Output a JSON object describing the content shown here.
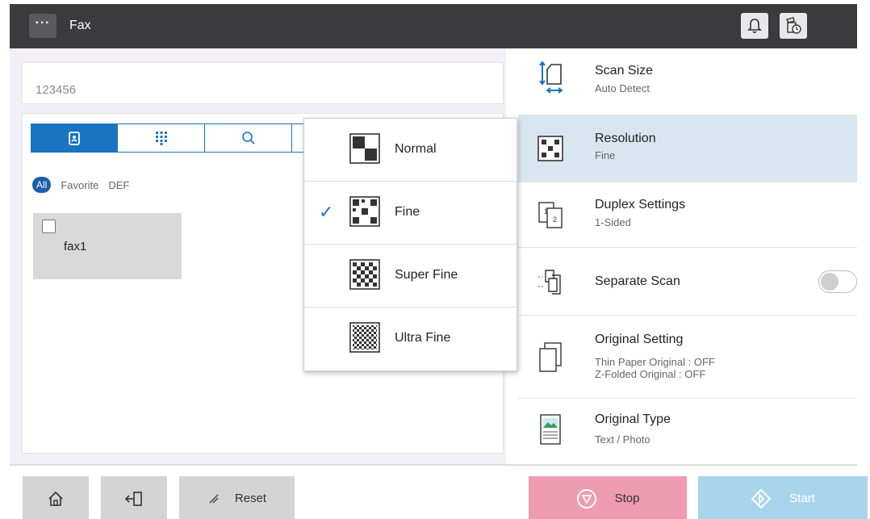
{
  "header": {
    "menu_label": "···",
    "title": "Fax",
    "icons": [
      "bell-icon",
      "job-status-icon"
    ]
  },
  "destination": {
    "fax_number": "123456"
  },
  "address_book": {
    "tabs": [
      "address-book-icon",
      "keypad-icon",
      "search-icon",
      "history-icon"
    ],
    "filters": {
      "all": "All",
      "favorite": "Favorite",
      "def": "DEF"
    },
    "entries": [
      {
        "label": "fax1",
        "checked": false
      }
    ]
  },
  "resolution_dropdown": {
    "items": [
      {
        "label": "Normal",
        "selected": false
      },
      {
        "label": "Fine",
        "selected": true
      },
      {
        "label": "Super Fine",
        "selected": false
      },
      {
        "label": "Ultra Fine",
        "selected": false
      }
    ],
    "check_glyph": "✓"
  },
  "settings": {
    "scan_size": {
      "title": "Scan Size",
      "value": "Auto Detect"
    },
    "resolution": {
      "title": "Resolution",
      "value": "Fine"
    },
    "duplex": {
      "title": "Duplex Settings",
      "value": "1-Sided"
    },
    "separate_scan": {
      "title": "Separate Scan",
      "enabled": false
    },
    "original_setting": {
      "title": "Original Setting",
      "line1": "Thin Paper Original : OFF",
      "line2": "Z-Folded Original : OFF"
    },
    "original_type": {
      "title": "Original Type",
      "value": "Text / Photo"
    }
  },
  "footer": {
    "reset_label": "Reset",
    "stop_label": "Stop",
    "start_label": "Start"
  },
  "colors": {
    "accent_blue": "#1a74c4",
    "selected_row": "#d8e7ef",
    "stop": "#ef9bb2",
    "start": "#a9d5ec",
    "top_bar": "#3b3b3d"
  }
}
